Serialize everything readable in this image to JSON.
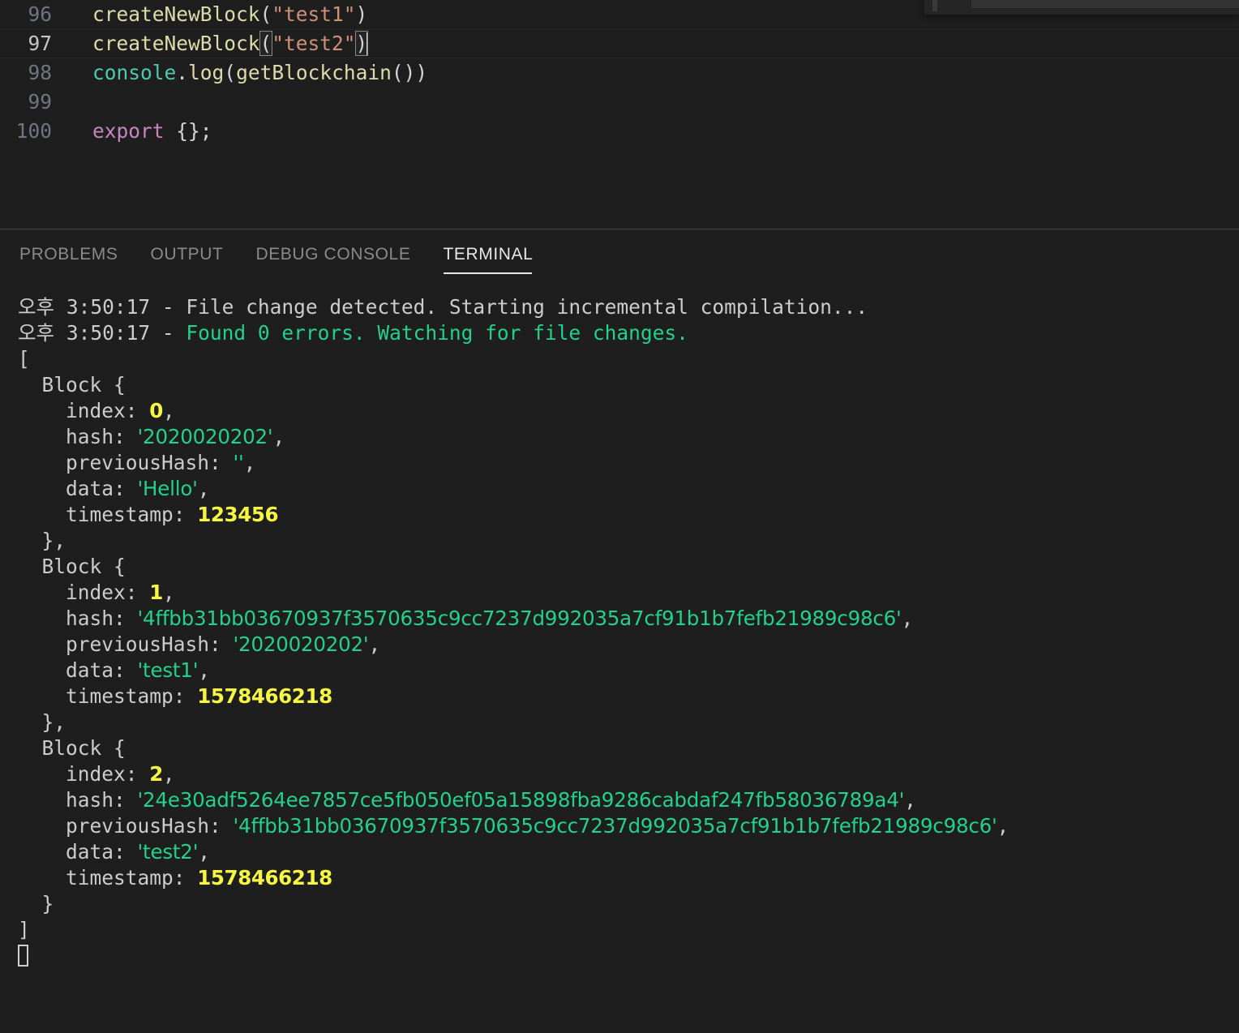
{
  "editor": {
    "lines": [
      {
        "number": "96",
        "active": false,
        "tokens": [
          {
            "t": "createNewBlock",
            "c": "fn"
          },
          {
            "t": "(",
            "c": "punc"
          },
          {
            "t": "\"test1\"",
            "c": "str"
          },
          {
            "t": ")",
            "c": "punc"
          }
        ]
      },
      {
        "number": "97",
        "active": true,
        "tokens": [
          {
            "t": "createNewBlock",
            "c": "fn"
          },
          {
            "t": "(",
            "c": "punc",
            "hl": true
          },
          {
            "t": "\"test2\"",
            "c": "str"
          },
          {
            "t": ")",
            "c": "punc",
            "hl": true
          }
        ]
      },
      {
        "number": "98",
        "active": false,
        "tokens": [
          {
            "t": "console",
            "c": "obj"
          },
          {
            "t": ".",
            "c": "plain"
          },
          {
            "t": "log",
            "c": "prop"
          },
          {
            "t": "(",
            "c": "punc"
          },
          {
            "t": "getBlockchain",
            "c": "fn"
          },
          {
            "t": "())",
            "c": "punc"
          }
        ]
      },
      {
        "number": "99",
        "active": false,
        "tokens": []
      },
      {
        "number": "100",
        "active": false,
        "tokens": [
          {
            "t": "export",
            "c": "kw"
          },
          {
            "t": " {};",
            "c": "plain"
          }
        ]
      }
    ]
  },
  "panel": {
    "tabs": [
      {
        "label": "PROBLEMS",
        "active": false
      },
      {
        "label": "OUTPUT",
        "active": false
      },
      {
        "label": "DEBUG CONSOLE",
        "active": false
      },
      {
        "label": "TERMINAL",
        "active": true
      }
    ]
  },
  "terminal": {
    "lines": [
      {
        "segs": [
          {
            "t": "오후 3:50:17 - File change detected. Starting incremental compilation...",
            "c": "white"
          }
        ]
      },
      {
        "segs": [
          {
            "t": "오후 3:50:17 - ",
            "c": "white"
          },
          {
            "t": "Found 0 errors. Watching for file changes.",
            "c": "green"
          }
        ]
      },
      {
        "segs": [
          {
            "t": "[",
            "c": "white"
          }
        ]
      },
      {
        "segs": [
          {
            "t": "  Block {",
            "c": "white"
          }
        ]
      },
      {
        "segs": [
          {
            "t": "    index: ",
            "c": "white"
          },
          {
            "t": "0",
            "c": "yellow",
            "num": true
          },
          {
            "t": ",",
            "c": "white"
          }
        ]
      },
      {
        "segs": [
          {
            "t": "    hash: ",
            "c": "white"
          },
          {
            "t": "'2020020202'",
            "c": "green",
            "hash": true
          },
          {
            "t": ",",
            "c": "white"
          }
        ]
      },
      {
        "segs": [
          {
            "t": "    previousHash: ",
            "c": "white"
          },
          {
            "t": "''",
            "c": "green",
            "hash": true
          },
          {
            "t": ",",
            "c": "white"
          }
        ]
      },
      {
        "segs": [
          {
            "t": "    data: ",
            "c": "white"
          },
          {
            "t": "'Hello'",
            "c": "green",
            "hash": true
          },
          {
            "t": ",",
            "c": "white"
          }
        ]
      },
      {
        "segs": [
          {
            "t": "    timestamp: ",
            "c": "white"
          },
          {
            "t": "123456",
            "c": "yellow",
            "num": true
          }
        ]
      },
      {
        "segs": [
          {
            "t": "  },",
            "c": "white"
          }
        ]
      },
      {
        "segs": [
          {
            "t": "  Block {",
            "c": "white"
          }
        ]
      },
      {
        "segs": [
          {
            "t": "    index: ",
            "c": "white"
          },
          {
            "t": "1",
            "c": "yellow",
            "num": true
          },
          {
            "t": ",",
            "c": "white"
          }
        ]
      },
      {
        "segs": [
          {
            "t": "    hash: ",
            "c": "white"
          },
          {
            "t": "'4ffbb31bb03670937f3570635c9cc7237d992035a7cf91b1b7fefb21989c98c6'",
            "c": "green",
            "hash": true
          },
          {
            "t": ",",
            "c": "white"
          }
        ]
      },
      {
        "segs": [
          {
            "t": "    previousHash: ",
            "c": "white"
          },
          {
            "t": "'2020020202'",
            "c": "green",
            "hash": true
          },
          {
            "t": ",",
            "c": "white"
          }
        ]
      },
      {
        "segs": [
          {
            "t": "    data: ",
            "c": "white"
          },
          {
            "t": "'test1'",
            "c": "green",
            "hash": true
          },
          {
            "t": ",",
            "c": "white"
          }
        ]
      },
      {
        "segs": [
          {
            "t": "    timestamp: ",
            "c": "white"
          },
          {
            "t": "1578466218",
            "c": "yellow",
            "num": true
          }
        ]
      },
      {
        "segs": [
          {
            "t": "  },",
            "c": "white"
          }
        ]
      },
      {
        "segs": [
          {
            "t": "  Block {",
            "c": "white"
          }
        ]
      },
      {
        "segs": [
          {
            "t": "    index: ",
            "c": "white"
          },
          {
            "t": "2",
            "c": "yellow",
            "num": true
          },
          {
            "t": ",",
            "c": "white"
          }
        ]
      },
      {
        "segs": [
          {
            "t": "    hash: ",
            "c": "white"
          },
          {
            "t": "'24e30adf5264ee7857ce5fb050ef05a15898fba9286cabdaf247fb58036789a4'",
            "c": "green",
            "hash": true
          },
          {
            "t": ",",
            "c": "white"
          }
        ]
      },
      {
        "segs": [
          {
            "t": "    previousHash: ",
            "c": "white"
          },
          {
            "t": "'4ffbb31bb03670937f3570635c9cc7237d992035a7cf91b1b7fefb21989c98c6'",
            "c": "green",
            "hash": true
          },
          {
            "t": ",",
            "c": "white"
          }
        ]
      },
      {
        "segs": [
          {
            "t": "    data: ",
            "c": "white"
          },
          {
            "t": "'test2'",
            "c": "green",
            "hash": true
          },
          {
            "t": ",",
            "c": "white"
          }
        ]
      },
      {
        "segs": [
          {
            "t": "    timestamp: ",
            "c": "white"
          },
          {
            "t": "1578466218",
            "c": "yellow",
            "num": true
          }
        ]
      },
      {
        "segs": [
          {
            "t": "  }",
            "c": "white"
          }
        ]
      },
      {
        "segs": [
          {
            "t": "]",
            "c": "white"
          }
        ]
      },
      {
        "segs": [],
        "cursor": true
      }
    ]
  },
  "colors": {
    "background": "#1e1e1e",
    "foreground": "#cccccc",
    "green": "#23d18b",
    "yellow": "#f5f543",
    "string": "#ce9178",
    "function": "#dcdcaa",
    "keyword": "#c586c0",
    "object": "#4ec9b0",
    "line_number": "#6e7681",
    "divider": "#454545"
  }
}
